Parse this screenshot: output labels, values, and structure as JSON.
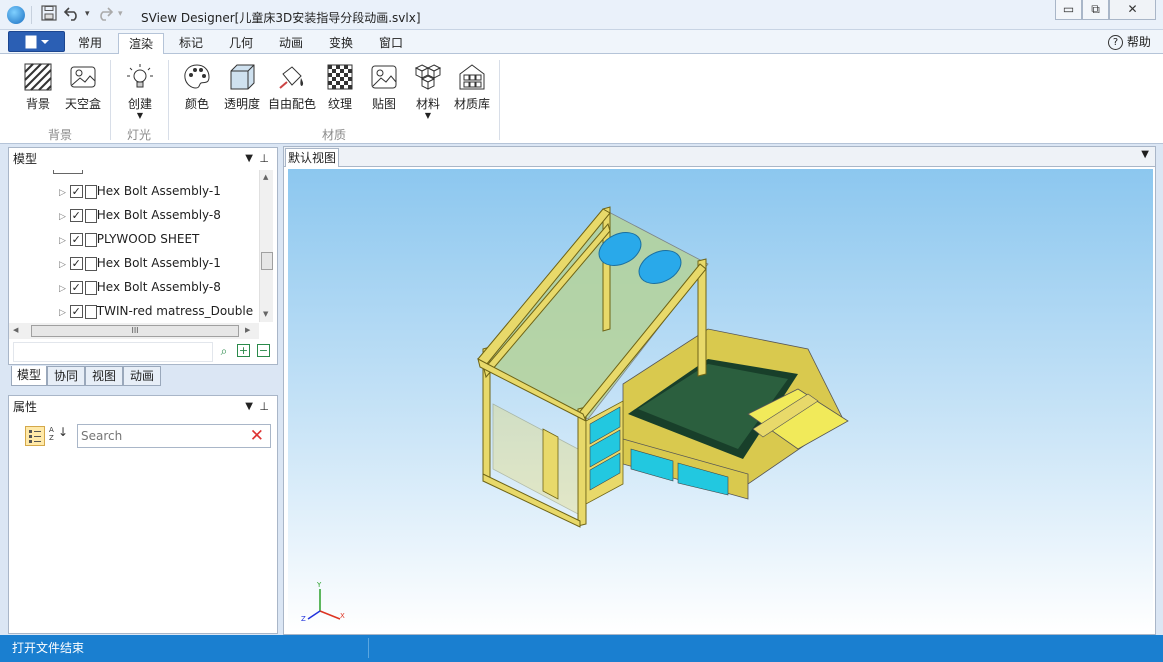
{
  "app": {
    "title": "SView Designer[儿童床3D安装指导分段动画.svlx]"
  },
  "window_controls": {
    "minimize": "▭",
    "restore": "⧉",
    "close": "✕"
  },
  "ribbon_tabs": [
    "常用",
    "渲染",
    "标记",
    "几何",
    "动画",
    "变换",
    "窗口"
  ],
  "active_tab": "渲染",
  "help_label": "帮助",
  "ribbon": {
    "buttons": [
      {
        "label": "背景",
        "icon": "hatch-icon"
      },
      {
        "label": "天空盒",
        "icon": "skybox-icon"
      },
      {
        "label": "创建",
        "icon": "light-bulb-icon"
      },
      {
        "label": "颜色",
        "icon": "palette-icon"
      },
      {
        "label": "透明度",
        "icon": "cube-icon"
      },
      {
        "label": "自由配色",
        "icon": "paint-bucket-icon"
      },
      {
        "label": "纹理",
        "icon": "checker-icon"
      },
      {
        "label": "贴图",
        "icon": "picture-icon"
      },
      {
        "label": "材料",
        "icon": "cubes-icon"
      },
      {
        "label": "材质库",
        "icon": "library-icon"
      }
    ],
    "groups": [
      "背景",
      "灯光",
      "材质"
    ]
  },
  "model_panel": {
    "title": "模型",
    "tree_items": [
      {
        "label": "Hex Bolt Assembly-1",
        "checked": true
      },
      {
        "label": "Hex Bolt Assembly-8",
        "checked": true
      },
      {
        "label": "PLYWOOD SHEET",
        "checked": true
      },
      {
        "label": "Hex Bolt Assembly-1",
        "checked": true
      },
      {
        "label": "Hex Bolt Assembly-8",
        "checked": true
      },
      {
        "label": "TWIN-red matress_Double",
        "checked": true
      }
    ],
    "scroll_thumb": "III"
  },
  "bottom_tabs": [
    "模型",
    "协同",
    "视图",
    "动画"
  ],
  "active_bottom_tab": "模型",
  "properties_panel": {
    "title": "属性",
    "sort_label": "A Z",
    "search_placeholder": "Search"
  },
  "viewport": {
    "tab_label": "默认视图",
    "axis_labels": {
      "x": "X",
      "y": "Y",
      "z": "Z"
    }
  },
  "status": {
    "text": "打开文件结束"
  },
  "colors": {
    "accent": "#2b5fb4",
    "status_bar": "#1a7fd0",
    "wood": "#e8d96a",
    "cyan": "#22c8e0"
  }
}
